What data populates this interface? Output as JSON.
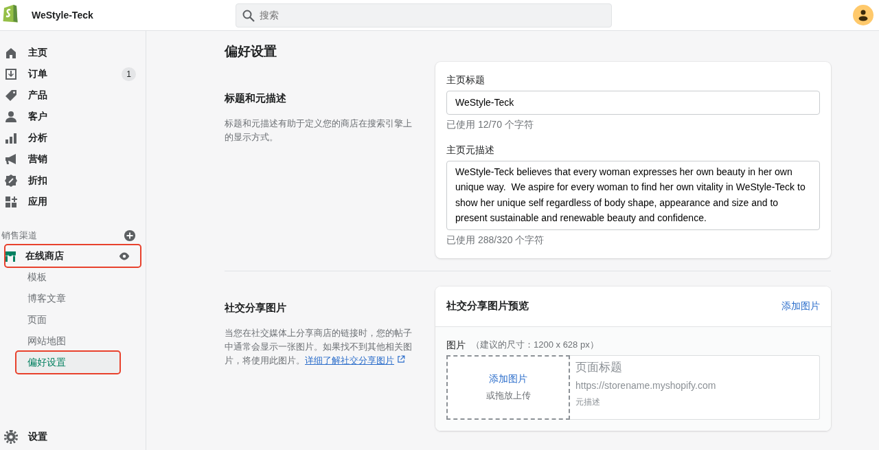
{
  "header": {
    "store_name": "WeStyle-Teck",
    "search": {
      "placeholder": "搜索"
    }
  },
  "sidebar": {
    "items": [
      {
        "kind": "home",
        "label": "主页",
        "selected": false
      },
      {
        "kind": "orders",
        "label": "订单",
        "badge": "1",
        "selected": false
      },
      {
        "kind": "products",
        "label": "产品",
        "selected": false
      },
      {
        "kind": "customers",
        "label": "客户",
        "selected": false
      },
      {
        "kind": "analytics",
        "label": "分析",
        "selected": false
      },
      {
        "kind": "marketing",
        "label": "营销",
        "selected": false
      },
      {
        "kind": "discounts",
        "label": "折扣",
        "selected": false
      },
      {
        "kind": "apps",
        "label": "应用",
        "selected": false
      }
    ],
    "channels_heading": "销售渠道",
    "channel": {
      "label": "在线商店",
      "highlighted": true,
      "children": [
        {
          "label": "模板",
          "selected": false,
          "highlighted": false
        },
        {
          "label": "博客文章",
          "selected": false,
          "highlighted": false
        },
        {
          "label": "页面",
          "selected": false,
          "highlighted": false
        },
        {
          "label": "网站地图",
          "selected": false,
          "highlighted": false
        },
        {
          "label": "偏好设置",
          "selected": true,
          "highlighted": true
        }
      ]
    },
    "settings": {
      "label": "设置"
    }
  },
  "page_title": "偏好设置",
  "seo_section": {
    "heading": "标题和元描述",
    "description": "标题和元描述有助于定义您的商店在搜索引擎上的显示方式。",
    "fields": [
      {
        "kind": "input",
        "label": "主页标题",
        "value": "WeStyle-Teck",
        "counter": "已使用 12/70 个字符"
      },
      {
        "kind": "textarea",
        "label": "主页元描述",
        "value": "WeStyle-Teck believes that every woman expresses her own beauty in her own unique way.  We aspire for every woman to find her own vitality in WeStyle-Teck to show her unique self regardless of body shape, appearance and size and to present sustainable and renewable beauty and confidence.",
        "counter": "已使用 288/320 个字符"
      }
    ]
  },
  "social_section": {
    "heading": "社交分享图片",
    "description": "当您在社交媒体上分享商店的链接时，您的帖子中通常会显示一张图片。如果找不到其他相关图片，将使用此图片。",
    "link": "详细了解社交分享图片",
    "card_title": "社交分享图片预览",
    "card_action": "添加图片",
    "image_label": "图片",
    "image_hint": "（建议的尺寸：1200 x 628 px）",
    "dropzone": {
      "action": "添加图片",
      "hint": "或拖放上传"
    },
    "preview": {
      "title": "页面标题",
      "url": "https://storename.myshopify.com",
      "description": "元描述"
    }
  }
}
